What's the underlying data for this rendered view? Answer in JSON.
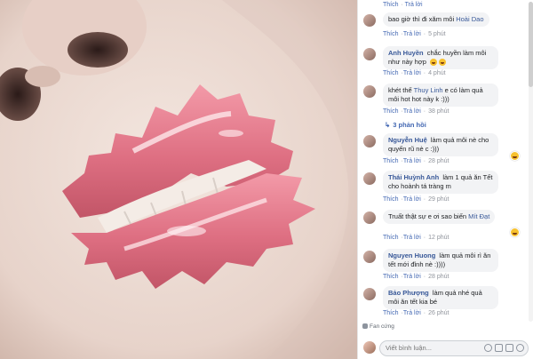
{
  "post_image": {
    "alt_icon": "photo"
  },
  "comments_panel": {
    "top_meta": {
      "like": "Thích",
      "reply": "Trả lời",
      "time": ""
    },
    "comments": [
      {
        "name": "",
        "text": "bao giờ thì đi xăm môi",
        "tag": "Hoài Dao",
        "like": "Thích",
        "reply": "Trả lời",
        "time": "5 phút"
      },
      {
        "name": "Anh Huyền",
        "text": "chắc huyền làm môi như này hợp",
        "tag": "",
        "like": "Thích",
        "reply": "Trả lời",
        "time": "4 phút"
      },
      {
        "name": "",
        "text": "khét thế",
        "tag": "Thuy Linh",
        "text2": "e có làm quả môi hot hot này k :)))",
        "like": "Thích",
        "reply": "Trả lời",
        "time": "38 phút"
      },
      {
        "name": "Nguyễn Huệ",
        "text": "làm quả môi nè cho quyến rũ nè c :)))",
        "tag": "",
        "like": "Thích",
        "reply": "Trả lời",
        "time": "28 phút"
      },
      {
        "name": "Thái Huỳnh Anh",
        "text": "làm 1 quả ăn Tết cho hoành tá tràng m",
        "tag": "",
        "like": "Thích",
        "reply": "Trả lời",
        "time": "29 phút"
      },
      {
        "name": "",
        "text": "Truất thật sự e ơi sao biến",
        "tag": "Mít Đạt",
        "like": "Thích",
        "reply": "Trả lời",
        "time": "12 phút"
      },
      {
        "name": "Nguyen Huong",
        "text": "làm quả môi rì ăn tết mới đỉnh nè :))))",
        "tag": "",
        "like": "Thích",
        "reply": "Trả lời",
        "time": "28 phút"
      },
      {
        "name": "Bảo Phượng",
        "text": "làm quả nhé quả môi ăn tết kia bé",
        "tag": "",
        "like": "Thích",
        "reply": "Trả lời",
        "time": "26 phút"
      }
    ],
    "replies_link": "3 phản hồi",
    "fan_label": "Fan cứng",
    "input_placeholder": "Viết bình luận..."
  }
}
